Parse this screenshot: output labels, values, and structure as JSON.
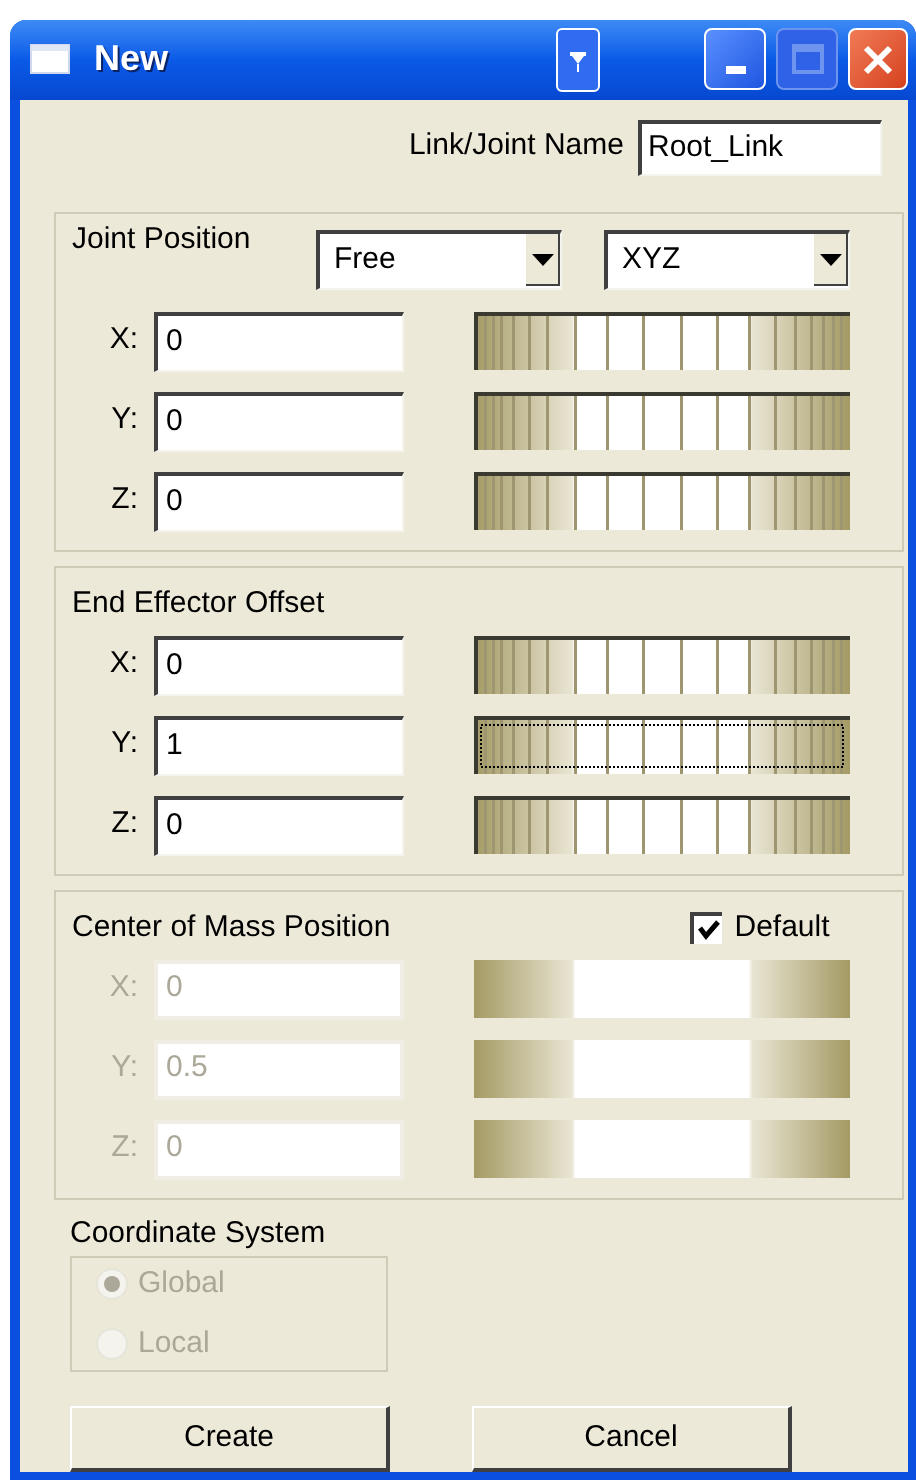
{
  "window": {
    "title": "New"
  },
  "link_joint_name": {
    "label": "Link/Joint Name",
    "value": "Root_Link"
  },
  "groups": [
    {
      "title": "Joint Position",
      "disabled": false,
      "dropdowns": [
        {
          "value": "Free"
        },
        {
          "value": "XYZ"
        }
      ],
      "rows": [
        {
          "label": "X:",
          "value": "0",
          "wheel_focused": false
        },
        {
          "label": "Y:",
          "value": "0",
          "wheel_focused": false
        },
        {
          "label": "Z:",
          "value": "0",
          "wheel_focused": false
        }
      ]
    },
    {
      "title": "End Effector Offset",
      "disabled": false,
      "rows": [
        {
          "label": "X:",
          "value": "0",
          "wheel_focused": false
        },
        {
          "label": "Y:",
          "value": "1",
          "wheel_focused": true
        },
        {
          "label": "Z:",
          "value": "0",
          "wheel_focused": false
        }
      ]
    },
    {
      "title": "Center of Mass Position",
      "disabled": true,
      "checkbox": {
        "label": "Default",
        "checked": true
      },
      "rows": [
        {
          "label": "X:",
          "value": "0",
          "wheel_focused": false
        },
        {
          "label": "Y:",
          "value": "0.5",
          "wheel_focused": false
        },
        {
          "label": "Z:",
          "value": "0",
          "wheel_focused": false
        }
      ]
    }
  ],
  "coordinate_system": {
    "title": "Coordinate System",
    "disabled": true,
    "options": [
      {
        "label": "Global",
        "selected": true
      },
      {
        "label": "Local",
        "selected": false
      }
    ]
  },
  "buttons": [
    "Create",
    "Cancel"
  ]
}
